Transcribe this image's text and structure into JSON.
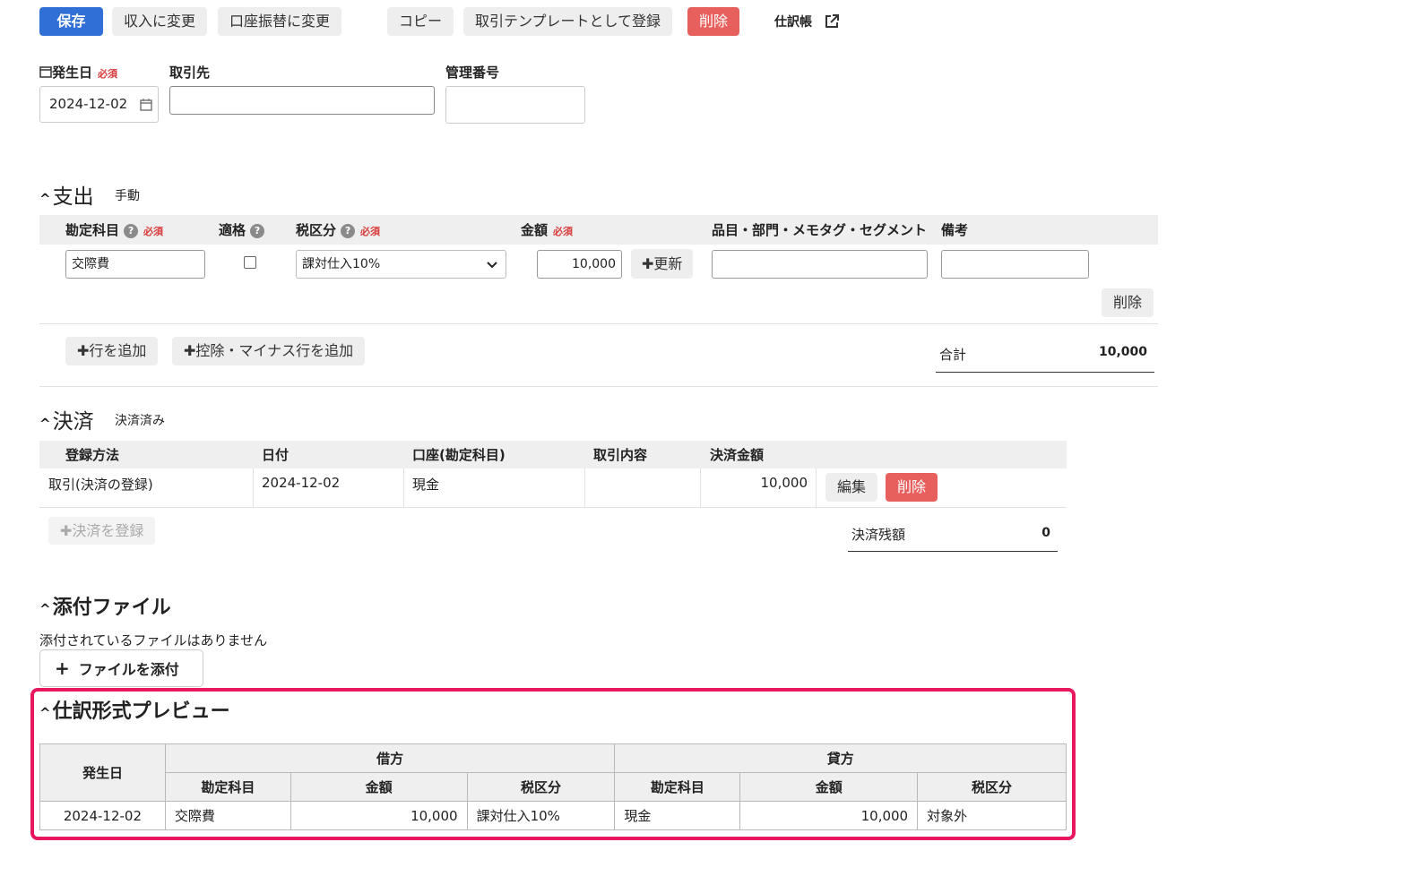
{
  "toolbar": {
    "save": "保存",
    "to_income": "収入に変更",
    "to_transfer": "口座振替に変更",
    "copy": "コピー",
    "register_template": "取引テンプレートとして登録",
    "delete": "削除",
    "journal_link": "仕訳帳"
  },
  "form": {
    "date_label": "発生日",
    "required": "必須",
    "date_value": "2024-12-02",
    "partner_label": "取引先",
    "partner_value": "",
    "manage_no_label": "管理番号",
    "manage_no_value": ""
  },
  "expense": {
    "title": "支出",
    "mode": "手動",
    "headers": {
      "account": "勘定科目",
      "qualified": "適格",
      "tax": "税区分",
      "amount": "金額",
      "item_segment": "品目・部門・メモタグ・セグメント",
      "remarks": "備考"
    },
    "row": {
      "account": "交際費",
      "qualified_checked": false,
      "tax": "課対仕入10%",
      "amount": "10,000",
      "update_button": "更新",
      "item_segment": "",
      "remarks": "",
      "delete_button": "削除"
    },
    "add_row": "行を追加",
    "add_deduction_row": "控除・マイナス行を追加",
    "total_label": "合計",
    "total_value": "10,000"
  },
  "settlement": {
    "title": "決済",
    "status": "決済済み",
    "headers": {
      "method": "登録方法",
      "date": "日付",
      "account": "口座(勘定科目)",
      "content": "取引内容",
      "amount": "決済金額"
    },
    "row": {
      "method": "取引(決済の登録)",
      "date": "2024-12-02",
      "account": "現金",
      "content": "",
      "amount": "10,000",
      "edit_button": "編集",
      "delete_button": "削除"
    },
    "register_button": "決済を登録",
    "balance_label": "決済残額",
    "balance_value": "0"
  },
  "attachments": {
    "title": "添付ファイル",
    "empty_text": "添付されているファイルはありません",
    "attach_button": "ファイルを添付"
  },
  "preview": {
    "title": "仕訳形式プレビュー",
    "date_header": "発生日",
    "debit_header": "借方",
    "credit_header": "貸方",
    "sub_headers": {
      "account": "勘定科目",
      "amount": "金額",
      "tax": "税区分"
    },
    "row": {
      "date": "2024-12-02",
      "debit_account": "交際費",
      "debit_amount": "10,000",
      "debit_tax": "課対仕入10%",
      "credit_account": "現金",
      "credit_amount": "10,000",
      "credit_tax": "対象外"
    }
  },
  "colors": {
    "primary": "#2f6fd6",
    "danger": "#e8605d",
    "required": "#d83a3a",
    "highlight": "#e8185f"
  }
}
